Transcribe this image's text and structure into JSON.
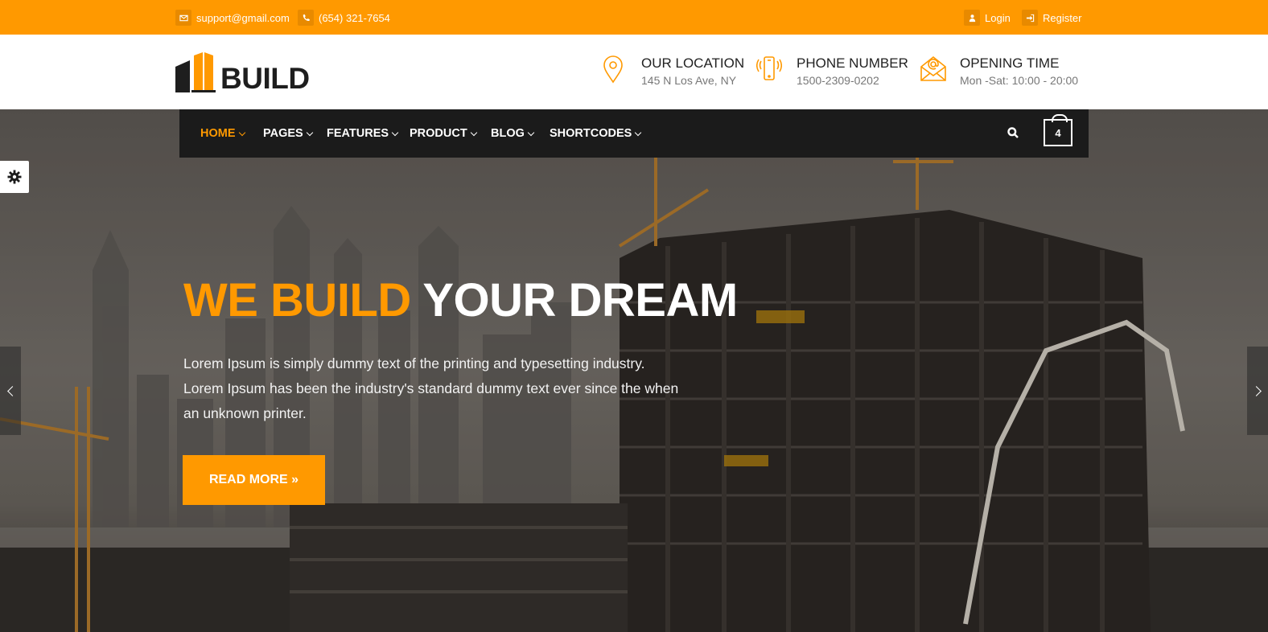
{
  "topbar": {
    "email": "support@gmail.com",
    "phone": "(654) 321-7654",
    "login": "Login",
    "register": "Register"
  },
  "brand": {
    "logo_text": "BUILD",
    "accent": "#ff9900"
  },
  "header_info": [
    {
      "title": "OUR LOCATION",
      "sub": "145 N Los Ave, NY",
      "icon": "map-pin-icon"
    },
    {
      "title": "PHONE NUMBER",
      "sub": "1500-2309-0202",
      "icon": "mobile-phone-icon"
    },
    {
      "title": "OPENING TIME",
      "sub": "Mon -Sat: 10:00 - 20:00",
      "icon": "envelope-icon"
    }
  ],
  "nav": {
    "items": [
      {
        "label": "HOME",
        "active": true
      },
      {
        "label": "PAGES",
        "active": false
      },
      {
        "label": "FEATURES",
        "active": false
      },
      {
        "label": "PRODUCT",
        "active": false
      },
      {
        "label": "BLOG",
        "active": false
      },
      {
        "label": "SHORTCODES",
        "active": false
      }
    ],
    "cart_count": "4"
  },
  "hero": {
    "title_highlight": "WE BUILD",
    "title_rest": "YOUR DREAM",
    "line1": "Lorem Ipsum is simply dummy text of the printing and typesetting industry.",
    "line2": "Lorem Ipsum has been the industry's standard dummy text ever since the when",
    "line3": "an unknown printer.",
    "button": "READ MORE »"
  }
}
